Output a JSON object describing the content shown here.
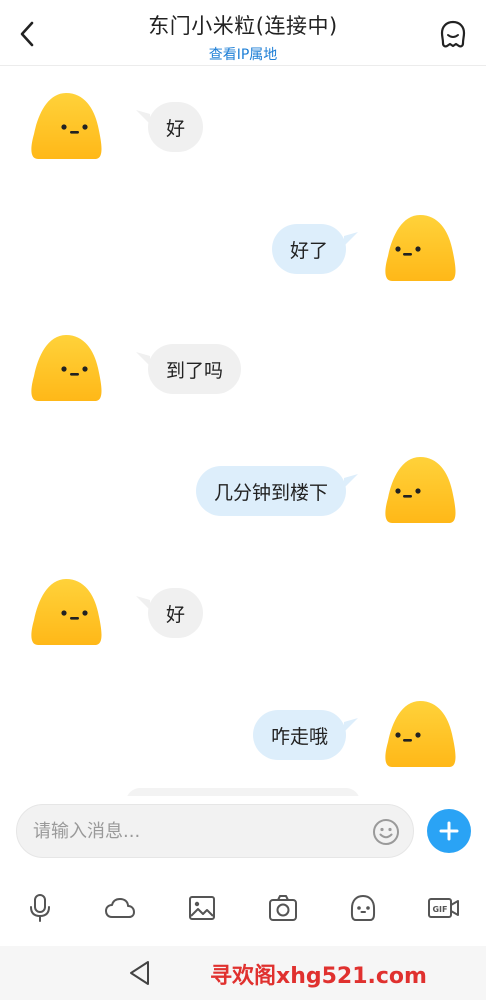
{
  "header": {
    "title": "东门小米粒(连接中)",
    "subtitle": "查看IP属地",
    "back_icon": "chevron-left-icon",
    "profile_icon": "user-profile-icon"
  },
  "messages": [
    {
      "side": "left",
      "text": "好"
    },
    {
      "side": "right",
      "text": "好了"
    },
    {
      "side": "left",
      "text": "到了吗"
    },
    {
      "side": "right",
      "text": "几分钟到楼下"
    },
    {
      "side": "left",
      "text": "好"
    },
    {
      "side": "right",
      "text": "咋走哦"
    }
  ],
  "input": {
    "placeholder": "请输入消息...",
    "value": ""
  },
  "toolbar": {
    "items": [
      "microphone-icon",
      "cloud-icon",
      "image-icon",
      "camera-icon",
      "emoji-face-icon",
      "gif-icon"
    ]
  },
  "navbar": {
    "watermark": "寻欢阁xhg521.com"
  },
  "colors": {
    "accent": "#2aa3f5",
    "link": "#1e7fd6",
    "bubble_left": "#f0f0f0",
    "bubble_right": "#ddeefb",
    "avatar": "#ffc928",
    "watermark": "#e0312f"
  }
}
